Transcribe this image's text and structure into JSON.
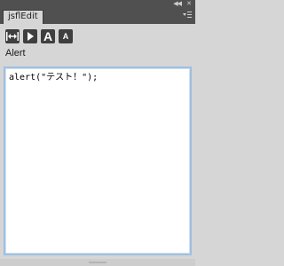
{
  "window": {
    "tab_label": "jsflEdit",
    "collapse_icon": "double-chevron-left-icon",
    "close_icon": "close-icon",
    "menu_icon": "panel-menu-icon"
  },
  "toolbar": {
    "buttons": [
      {
        "name": "expand-width-button",
        "icon": "double-arrow-horizontal-icon"
      },
      {
        "name": "run-button",
        "icon": "play-icon"
      },
      {
        "name": "increase-font-button",
        "label": "A"
      },
      {
        "name": "decrease-font-button",
        "label": "A"
      }
    ]
  },
  "main": {
    "label": "Alert",
    "code": "alert(\"テスト！\");"
  },
  "colors": {
    "titlebar": "#505050",
    "panel": "#d6d6d6",
    "button": "#3f3f3f",
    "editor_focus_border": "#9fbfe0"
  }
}
